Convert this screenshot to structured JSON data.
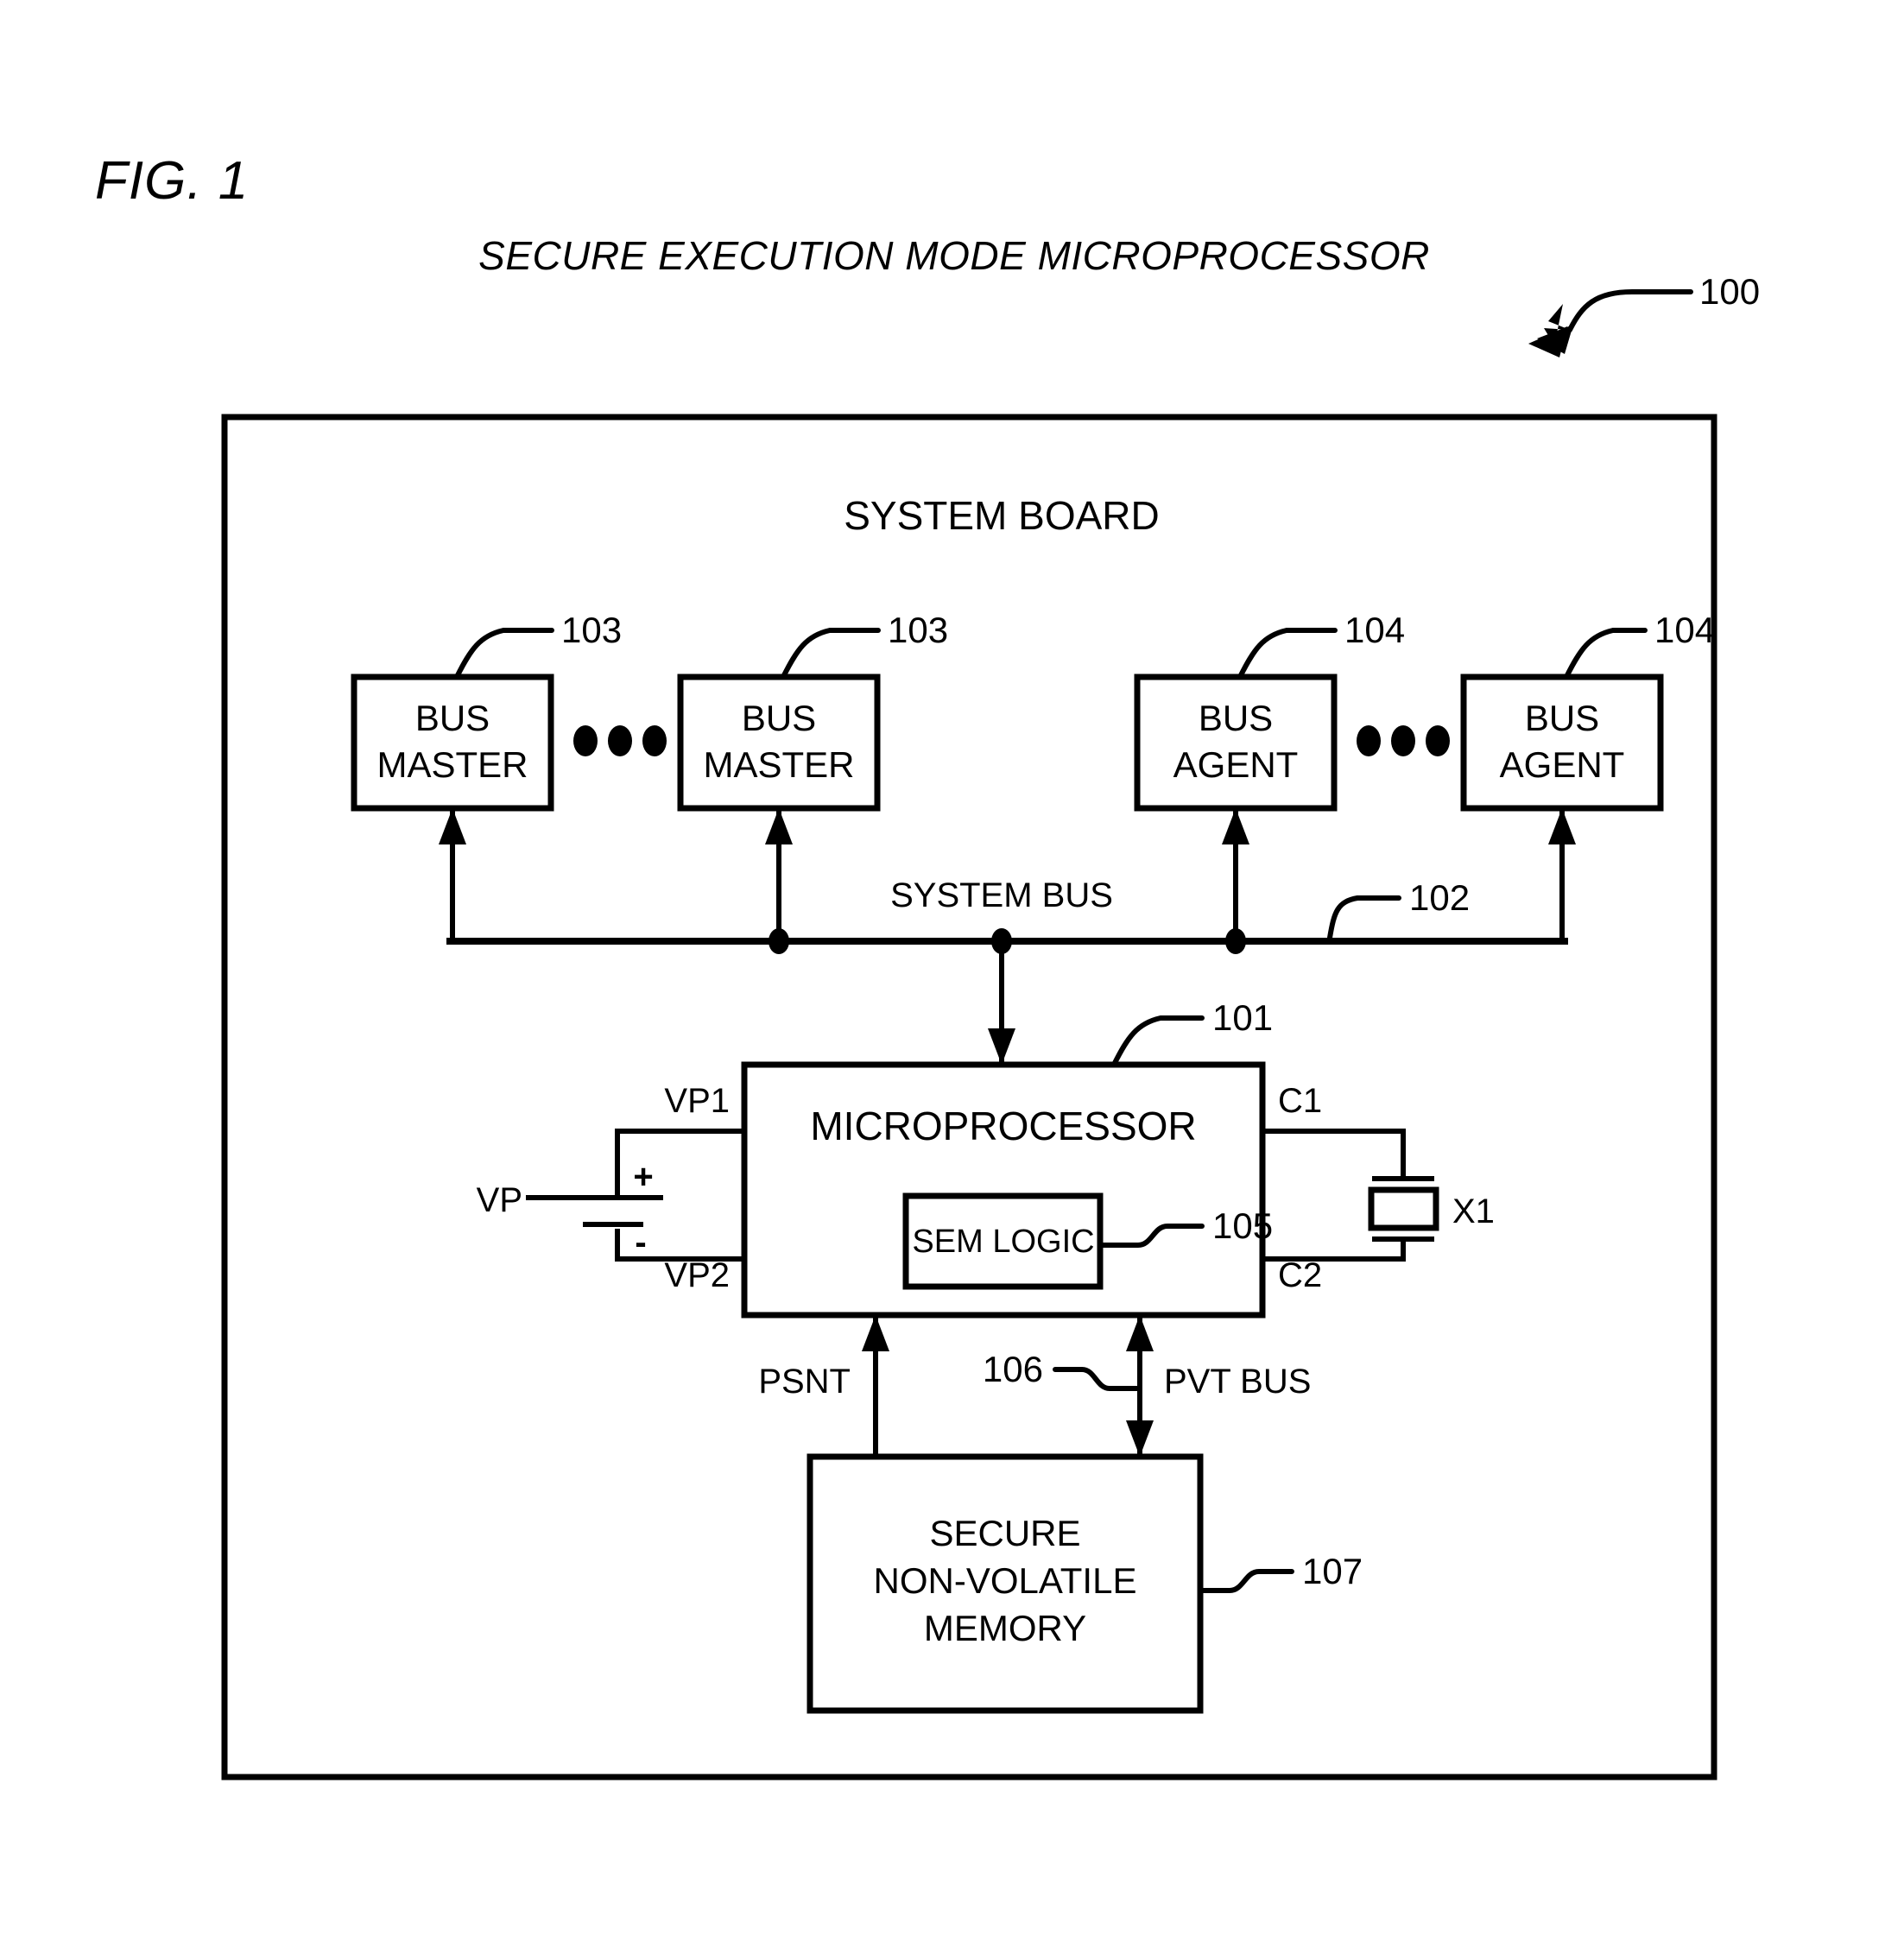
{
  "figure": {
    "label": "FIG. 1",
    "title": "SECURE EXECUTION MODE MICROPROCESSOR",
    "overall_ref": "100"
  },
  "board": {
    "name": "SYSTEM BOARD"
  },
  "bus_masters": [
    {
      "line1": "BUS",
      "line2": "MASTER",
      "ref": "103"
    },
    {
      "line1": "BUS",
      "line2": "MASTER",
      "ref": "103"
    }
  ],
  "bus_agents": [
    {
      "line1": "BUS",
      "line2": "AGENT",
      "ref": "104"
    },
    {
      "line1": "BUS",
      "line2": "AGENT",
      "ref": "104"
    }
  ],
  "ellipsis": {
    "masters": "•••",
    "agents": "•••"
  },
  "system_bus": {
    "label": "SYSTEM BUS",
    "ref": "102"
  },
  "microprocessor": {
    "label": "MICROPROCESSOR",
    "ref": "101",
    "sem_logic": {
      "label": "SEM LOGIC",
      "ref": "105"
    },
    "pins": {
      "vp1": "VP1",
      "vp2": "VP2",
      "c1": "C1",
      "c2": "C2"
    }
  },
  "power": {
    "source_label": "VP",
    "plus": "+",
    "minus": "-"
  },
  "crystal": {
    "label": "X1"
  },
  "signals": {
    "psnt": "PSNT",
    "pvt_bus": "PVT BUS",
    "pvt_bus_ref": "106"
  },
  "memory": {
    "line1": "SECURE",
    "line2": "NON-VOLATILE",
    "line3": "MEMORY",
    "ref": "107"
  },
  "colors": {
    "ink": "#000000",
    "paper": "#ffffff"
  }
}
